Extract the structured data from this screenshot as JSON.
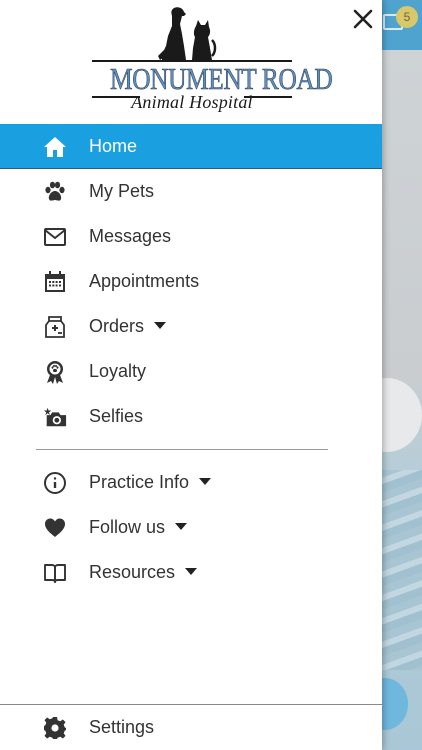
{
  "background": {
    "mail_badge_count": "5"
  },
  "logo": {
    "main_text": "MONUMENT ROAD",
    "sub_text": "Animal Hospital"
  },
  "menu": {
    "items": [
      {
        "label": "Home",
        "icon": "home-icon",
        "active": true
      },
      {
        "label": "My Pets",
        "icon": "paw-icon"
      },
      {
        "label": "Messages",
        "icon": "envelope-icon"
      },
      {
        "label": "Appointments",
        "icon": "calendar-icon"
      },
      {
        "label": "Orders",
        "icon": "medicine-bag-icon",
        "has_dropdown": true
      },
      {
        "label": "Loyalty",
        "icon": "award-ribbon-icon"
      },
      {
        "label": "Selfies",
        "icon": "camera-icon"
      }
    ],
    "secondary": [
      {
        "label": "Practice Info",
        "icon": "info-icon",
        "has_dropdown": true
      },
      {
        "label": "Follow us",
        "icon": "heart-icon",
        "has_dropdown": true
      },
      {
        "label": "Resources",
        "icon": "book-icon",
        "has_dropdown": true
      }
    ],
    "footer": {
      "label": "Settings",
      "icon": "gear-icon"
    }
  },
  "colors": {
    "accent": "#1a9fe0",
    "text": "#333333",
    "icon": "#333333"
  }
}
